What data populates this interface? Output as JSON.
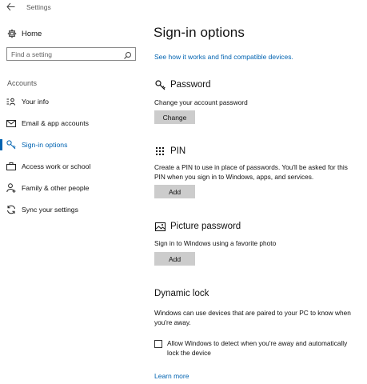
{
  "window": {
    "title": "Settings"
  },
  "sidebar": {
    "home_label": "Home",
    "search_placeholder": "Find a setting",
    "section_label": "Accounts",
    "items": [
      {
        "label": "Your info",
        "icon": "person-list-icon"
      },
      {
        "label": "Email & app accounts",
        "icon": "mail-icon"
      },
      {
        "label": "Sign-in options",
        "icon": "key-icon",
        "active": true
      },
      {
        "label": "Access work or school",
        "icon": "briefcase-icon"
      },
      {
        "label": "Family & other people",
        "icon": "add-person-icon"
      },
      {
        "label": "Sync your settings",
        "icon": "sync-icon"
      }
    ]
  },
  "main": {
    "title": "Sign-in options",
    "top_link": "See how it works and find compatible devices.",
    "password": {
      "heading": "Password",
      "description": "Change your account password",
      "button": "Change"
    },
    "pin": {
      "heading": "PIN",
      "description_line1": "Create a PIN to use in place of passwords. You'll be asked for this",
      "description_line2": "PIN when you sign in to Windows, apps, and services.",
      "button": "Add"
    },
    "picture_password": {
      "heading": "Picture password",
      "description": "Sign in to Windows using a favorite photo",
      "button": "Add"
    },
    "dynamic_lock": {
      "heading": "Dynamic lock",
      "description_line1": "Windows can use devices that are paired to your PC to know when",
      "description_line2": "you're away.",
      "checkbox_line1": "Allow Windows to detect when you're away and automatically",
      "checkbox_line2": "lock the device",
      "checked": false,
      "learn_more": "Learn more"
    }
  },
  "colors": {
    "accent": "#0063b1",
    "button_bg": "#cccccc"
  }
}
